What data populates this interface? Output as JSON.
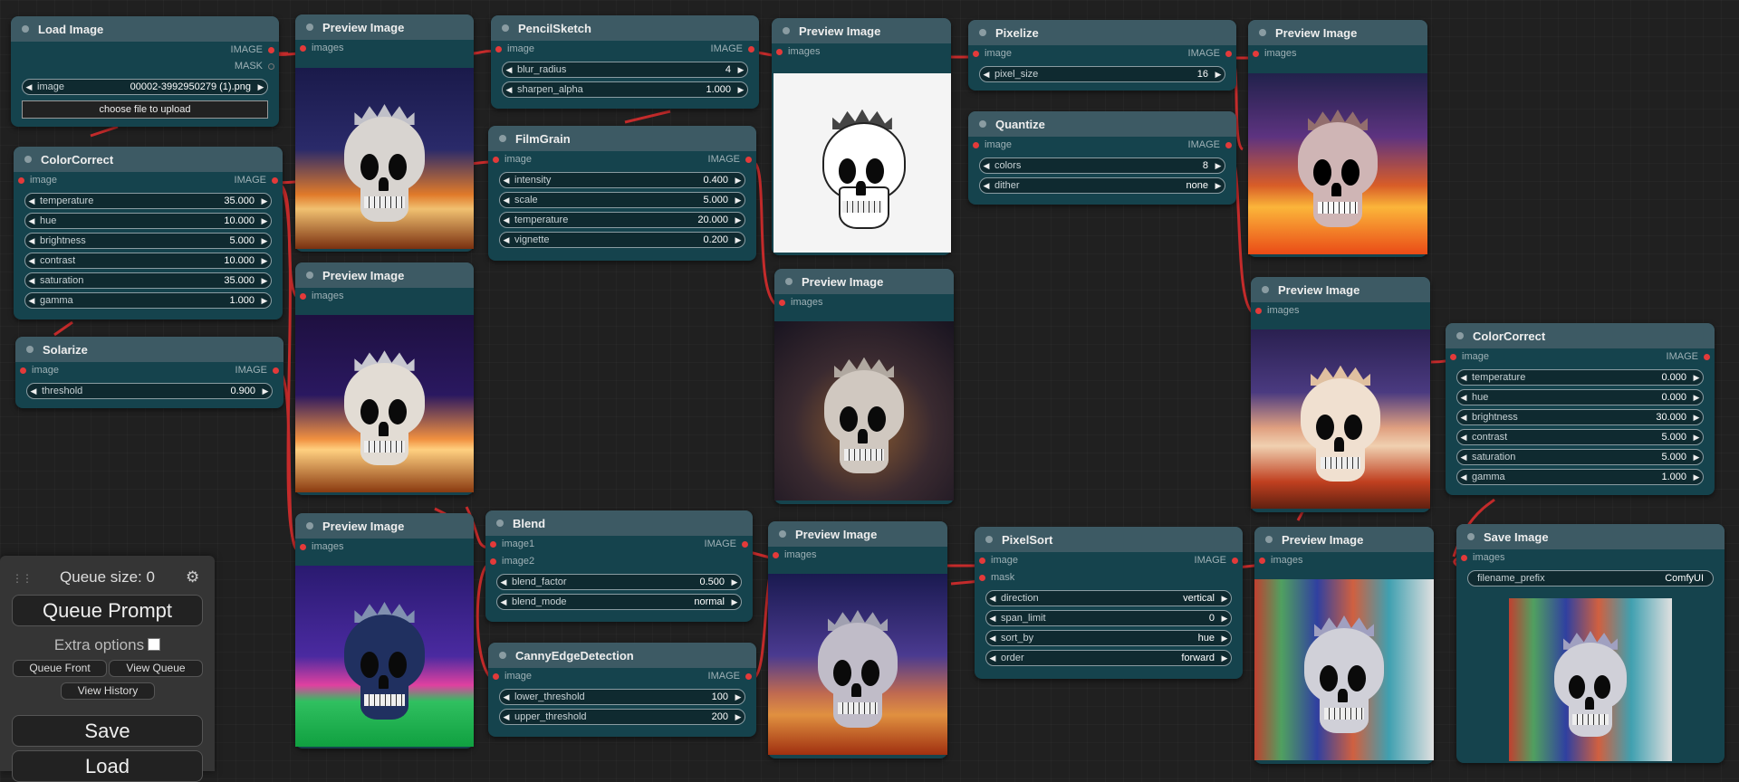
{
  "nodes": {
    "load_image": {
      "title": "Load Image",
      "out1": "IMAGE",
      "out2": "MASK",
      "widget_name": "image",
      "widget_value": "00002-3992950279 (1).png",
      "upload_label": "choose file to upload"
    },
    "color_correct_1": {
      "title": "ColorCorrect",
      "in": "image",
      "out": "IMAGE",
      "widgets": [
        {
          "name": "temperature",
          "value": "35.000"
        },
        {
          "name": "hue",
          "value": "10.000"
        },
        {
          "name": "brightness",
          "value": "5.000"
        },
        {
          "name": "contrast",
          "value": "10.000"
        },
        {
          "name": "saturation",
          "value": "35.000"
        },
        {
          "name": "gamma",
          "value": "1.000"
        }
      ]
    },
    "solarize": {
      "title": "Solarize",
      "in": "image",
      "out": "IMAGE",
      "widget_name": "threshold",
      "widget_value": "0.900"
    },
    "preview_1": {
      "title": "Preview Image",
      "in": "images"
    },
    "preview_2": {
      "title": "Preview Image",
      "in": "images"
    },
    "preview_3": {
      "title": "Preview Image",
      "in": "images"
    },
    "pencil_sketch": {
      "title": "PencilSketch",
      "in": "image",
      "out": "IMAGE",
      "widgets": [
        {
          "name": "blur_radius",
          "value": "4"
        },
        {
          "name": "sharpen_alpha",
          "value": "1.000"
        }
      ]
    },
    "film_grain": {
      "title": "FilmGrain",
      "in": "image",
      "out": "IMAGE",
      "widgets": [
        {
          "name": "intensity",
          "value": "0.400"
        },
        {
          "name": "scale",
          "value": "5.000"
        },
        {
          "name": "temperature",
          "value": "20.000"
        },
        {
          "name": "vignette",
          "value": "0.200"
        }
      ]
    },
    "blend": {
      "title": "Blend",
      "in1": "image1",
      "in2": "image2",
      "out": "IMAGE",
      "widgets": [
        {
          "name": "blend_factor",
          "value": "0.500"
        },
        {
          "name": "blend_mode",
          "value": "normal"
        }
      ]
    },
    "canny": {
      "title": "CannyEdgeDetection",
      "in": "image",
      "out": "IMAGE",
      "widgets": [
        {
          "name": "lower_threshold",
          "value": "100"
        },
        {
          "name": "upper_threshold",
          "value": "200"
        }
      ]
    },
    "preview_4": {
      "title": "Preview Image",
      "in": "images"
    },
    "preview_5": {
      "title": "Preview Image",
      "in": "images"
    },
    "preview_6": {
      "title": "Preview Image",
      "in": "images"
    },
    "pixelize": {
      "title": "Pixelize",
      "in": "image",
      "out": "IMAGE",
      "widget_name": "pixel_size",
      "widget_value": "16"
    },
    "quantize": {
      "title": "Quantize",
      "in": "image",
      "out": "IMAGE",
      "widgets": [
        {
          "name": "colors",
          "value": "8"
        },
        {
          "name": "dither",
          "value": "none"
        }
      ]
    },
    "pixel_sort": {
      "title": "PixelSort",
      "in1": "image",
      "in2": "mask",
      "out": "IMAGE",
      "widgets": [
        {
          "name": "direction",
          "value": "vertical"
        },
        {
          "name": "span_limit",
          "value": "0"
        },
        {
          "name": "sort_by",
          "value": "hue"
        },
        {
          "name": "order",
          "value": "forward"
        }
      ]
    },
    "preview_7": {
      "title": "Preview Image",
      "in": "images"
    },
    "preview_8": {
      "title": "Preview Image",
      "in": "images"
    },
    "preview_9": {
      "title": "Preview Image",
      "in": "images"
    },
    "color_correct_2": {
      "title": "ColorCorrect",
      "in": "image",
      "out": "IMAGE",
      "widgets": [
        {
          "name": "temperature",
          "value": "0.000"
        },
        {
          "name": "hue",
          "value": "0.000"
        },
        {
          "name": "brightness",
          "value": "30.000"
        },
        {
          "name": "contrast",
          "value": "5.000"
        },
        {
          "name": "saturation",
          "value": "5.000"
        },
        {
          "name": "gamma",
          "value": "1.000"
        }
      ]
    },
    "save_image": {
      "title": "Save Image",
      "in": "images",
      "widget_name": "filename_prefix",
      "widget_value": "ComfyUI"
    }
  },
  "sidebar": {
    "queue_size": "Queue size: 0",
    "queue_prompt": "Queue Prompt",
    "extra_options": "Extra options",
    "queue_front": "Queue Front",
    "view_queue": "View Queue",
    "view_history": "View History",
    "save": "Save",
    "load": "Load"
  },
  "colors": {
    "wire": "#e33a3a",
    "node_bg": "#15434d",
    "title_bg": "#3d5a64",
    "canvas": "#202020"
  }
}
